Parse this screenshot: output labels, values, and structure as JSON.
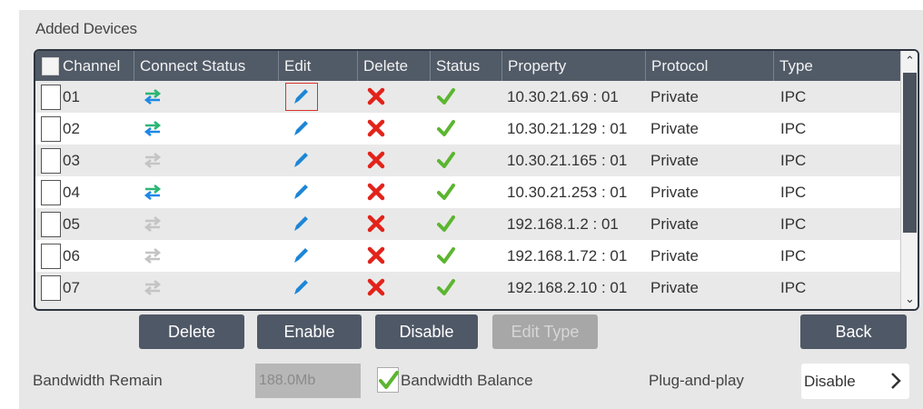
{
  "section_title": "Added Devices",
  "columns": {
    "channel": "Channel",
    "connect_status": "Connect Status",
    "edit": "Edit",
    "delete": "Delete",
    "status": "Status",
    "property": "Property",
    "protocol": "Protocol",
    "type": "Type"
  },
  "rows": [
    {
      "channel": "01",
      "connected": true,
      "property": "10.30.21.69 : 01",
      "protocol": "Private",
      "type": "IPC"
    },
    {
      "channel": "02",
      "connected": true,
      "property": "10.30.21.129 : 01",
      "protocol": "Private",
      "type": "IPC"
    },
    {
      "channel": "03",
      "connected": false,
      "property": "10.30.21.165 : 01",
      "protocol": "Private",
      "type": "IPC"
    },
    {
      "channel": "04",
      "connected": true,
      "property": "10.30.21.253 : 01",
      "protocol": "Private",
      "type": "IPC"
    },
    {
      "channel": "05",
      "connected": false,
      "property": "192.168.1.2 : 01",
      "protocol": "Private",
      "type": "IPC"
    },
    {
      "channel": "06",
      "connected": false,
      "property": "192.168.1.72 : 01",
      "protocol": "Private",
      "type": "IPC"
    },
    {
      "channel": "07",
      "connected": false,
      "property": "192.168.2.10 : 01",
      "protocol": "Private",
      "type": "IPC"
    }
  ],
  "buttons": {
    "delete": "Delete",
    "enable": "Enable",
    "disable": "Disable",
    "edit_type": "Edit Type",
    "back": "Back"
  },
  "bandwidth_remain": {
    "label": "Bandwidth Remain",
    "value": "188.0Mb"
  },
  "bandwidth_balance": {
    "label": "Bandwidth Balance",
    "checked": true
  },
  "plug_and_play": {
    "label": "Plug-and-play",
    "value": "Disable"
  },
  "colors": {
    "header_bg": "#515a67",
    "button_bg": "#4f5866",
    "connected_green": "#2bb673",
    "connected_blue": "#1e88e5",
    "disconnected_gray": "#c4c4c4",
    "delete_red": "#e2231a",
    "status_green": "#5cb531",
    "edit_blue": "#1c86d6"
  }
}
